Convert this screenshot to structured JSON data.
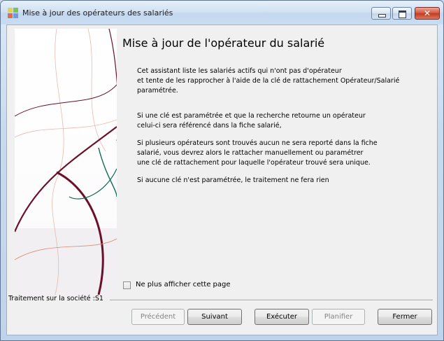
{
  "window": {
    "title": "Mise à jour des opérateurs des salariés",
    "minimize_icon": "minimize-icon",
    "maximize_icon": "maximize-icon",
    "close_icon": "close-icon",
    "close_glyph": "✕"
  },
  "wizard": {
    "heading": "Mise à jour de l'opérateur du salarié",
    "paragraphs": [
      [
        "Cet assistant liste les salariés actifs qui n'ont pas d'opérateur",
        "et tente de les rapprocher à l'aide de la clé de rattachement Opérateur/Salarié",
        "paramétrée."
      ],
      [
        "Si une clé est paramétrée et que la recherche retourne un opérateur",
        "celui-ci sera référencé dans la fiche salarié,"
      ],
      [
        "Si plusieurs opérateurs sont trouvés aucun ne sera reporté dans la fiche",
        "salarié, vous devrez alors le rattacher manuellement ou paramétrer",
        "une clé de rattachement pour laquelle l'opérateur trouvé sera unique."
      ],
      [
        "Si aucune clé n'est paramétrée, le traitement ne fera rien"
      ]
    ],
    "checkbox_label": "Ne plus afficher cette page",
    "checkbox_checked": false,
    "status": "Traitement sur la société :S1"
  },
  "buttons": {
    "previous": "Précédent",
    "next": "Suivant",
    "execute": "Exécuter",
    "schedule": "Planifier",
    "close": "Fermer"
  },
  "colors": {
    "curve_dark_red": "#6b0f2a",
    "curve_teal": "#0f6a55",
    "curve_salmon": "#d98a7a"
  }
}
